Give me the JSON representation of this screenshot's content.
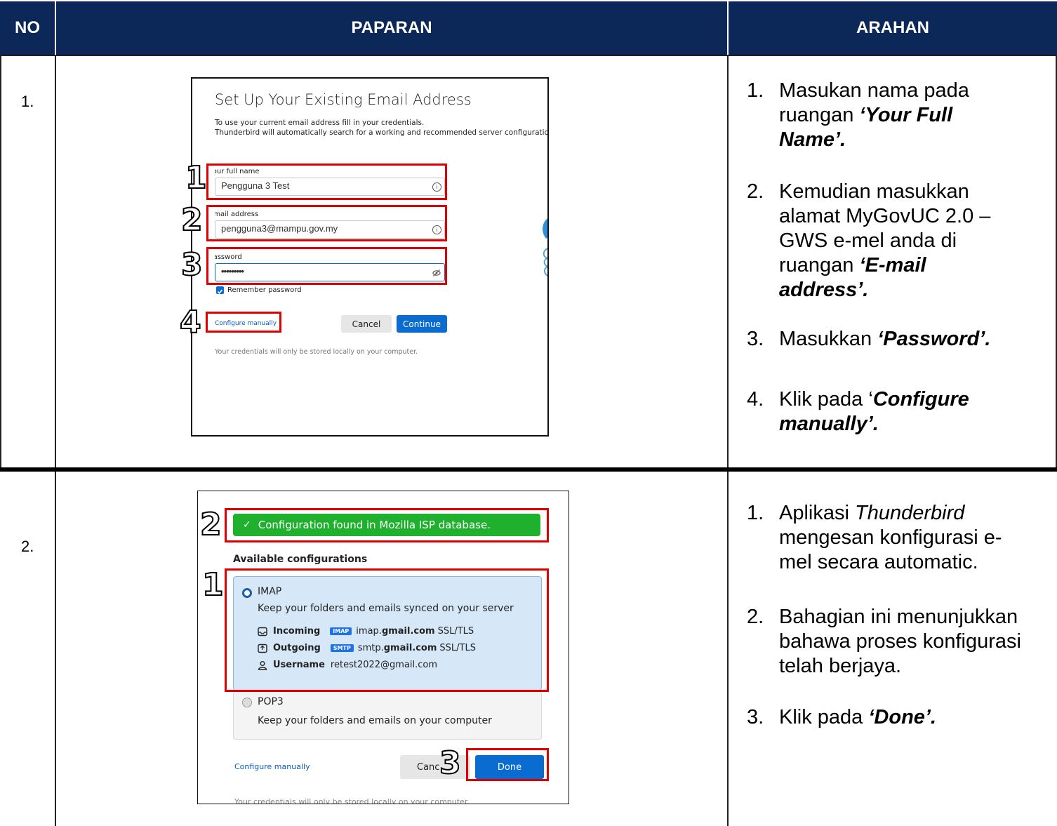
{
  "table": {
    "headers": [
      "NO",
      "PAPARAN",
      "ARAHAN"
    ],
    "rows": [
      {
        "no": "1.",
        "instructions": [
          {
            "num": "1.",
            "lines": [
              [
                {
                  "t": "Masukan nama pada"
                }
              ],
              [
                {
                  "t": "ruangan "
                },
                {
                  "t": "‘Your  Full",
                  "s": "bi"
                }
              ],
              [
                {
                  "t": "Name’.",
                  "s": "bi"
                }
              ]
            ]
          },
          {
            "num": "2.",
            "lines": [
              [
                {
                  "t": "Kemudian masukkan"
                }
              ],
              [
                {
                  "t": "alamat MyGovUC 2.0 –"
                }
              ],
              [
                {
                  "t": "GWS e-mel anda di"
                }
              ],
              [
                {
                  "t": "ruangan "
                },
                {
                  "t": "‘E-mail",
                  "s": "bi"
                }
              ],
              [
                {
                  "t": "address’.",
                  "s": "bi"
                }
              ]
            ]
          },
          {
            "num": "3.",
            "lines": [
              [
                {
                  "t": "Masukkan "
                },
                {
                  "t": "‘Password’.",
                  "s": "bi"
                }
              ]
            ]
          },
          {
            "num": "4.",
            "lines": [
              [
                {
                  "t": "Klik pada ‘"
                },
                {
                  "t": "Configure",
                  "s": "bi"
                }
              ],
              [
                {
                  "t": "manually’.",
                  "s": "bi"
                }
              ]
            ]
          }
        ]
      },
      {
        "no": "2.",
        "instructions": [
          {
            "num": "1.",
            "lines": [
              [
                {
                  "t": "Aplikasi "
                },
                {
                  "t": "Thunderbird",
                  "s": "it"
                }
              ],
              [
                {
                  "t": "mengesan konfigurasi e-"
                }
              ],
              [
                {
                  "t": "mel secara automatic."
                }
              ]
            ]
          },
          {
            "num": "2.",
            "lines": [
              [
                {
                  "t": "Bahagian ini menunjukkan"
                }
              ],
              [
                {
                  "t": "bahawa proses konfigurasi"
                }
              ],
              [
                {
                  "t": "telah berjaya."
                }
              ]
            ]
          },
          {
            "num": "3.",
            "lines": [
              [
                {
                  "t": "Klik pada "
                },
                {
                  "t": "‘Done’.",
                  "s": "bi"
                }
              ]
            ]
          }
        ]
      }
    ]
  },
  "shot1": {
    "title": "Set Up Your Existing Email Address",
    "desc1": "To use your current email address fill in your credentials.",
    "desc2": "Thunderbird will automatically search for a working and recommended server configuration.",
    "fullname_label": "Your full name",
    "fullname_value": "Pengguna 3 Test",
    "email_label": "Email address",
    "email_value": "pengguna3@mampu.gov.my",
    "password_label": "Password",
    "password_value": "•••••••••",
    "remember": "Remember password",
    "configure": "Configure manually",
    "cancel": "Cancel",
    "continue": "Continue",
    "footer": "Your credentials will only be stored locally on your computer.",
    "markers": [
      "1",
      "2",
      "3",
      "4"
    ]
  },
  "shot2": {
    "banner": "Configuration found in Mozilla ISP database.",
    "available": "Available configurations",
    "imap_title": "IMAP",
    "imap_desc": "Keep your folders and emails synced on your server",
    "incoming_label": "Incoming",
    "incoming_tag": "IMAP",
    "incoming_host_pre": "imap.",
    "incoming_host_bold": "gmail.com",
    "incoming_sec": "SSL/TLS",
    "outgoing_label": "Outgoing",
    "outgoing_tag": "SMTP",
    "outgoing_host_pre": "smtp.",
    "outgoing_host_bold": "gmail.com",
    "outgoing_sec": "SSL/TLS",
    "username_label": "Username",
    "username_value": "retest2022@gmail.com",
    "pop3_title": "POP3",
    "pop3_desc": "Keep your folders and emails on your computer",
    "configure": "Configure manually",
    "cancel": "Canc",
    "done": "Done",
    "footer": "Your credentials will only be stored locally on your computer.",
    "markers": [
      "1",
      "2",
      "3"
    ]
  },
  "colors": {
    "header_bg": "#0c2859",
    "highlight": "#e00000",
    "green": "#1fb02d",
    "accent": "#0a6bd0"
  }
}
